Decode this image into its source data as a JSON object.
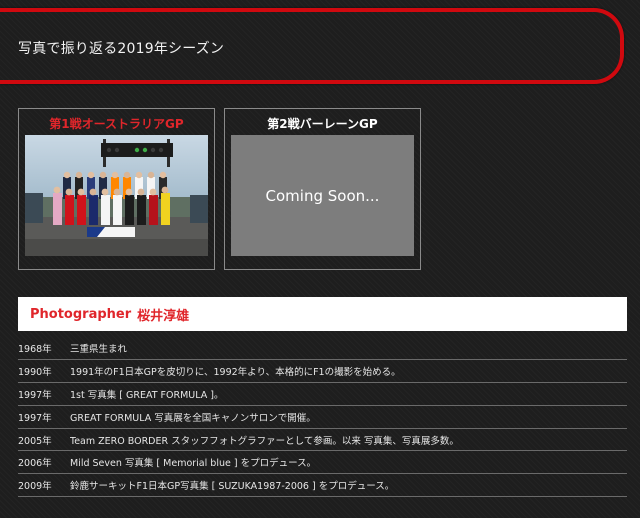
{
  "header": {
    "title": "写真で振り返る2019年シーズン",
    "border_color": "#d0090f"
  },
  "gp_cards": [
    {
      "title": "第1戦オーストラリアGP",
      "title_color": "#e0262b",
      "media": "team-photo"
    },
    {
      "title": "第2戦バーレーンGP",
      "title_color": "#ffffff",
      "placeholder_text": "Coming Soon..."
    }
  ],
  "photographer": {
    "label": "Photographer",
    "name": "桜井淳雄",
    "color": "#e0262b"
  },
  "history": [
    {
      "year": "1968年",
      "desc": "三重県生まれ"
    },
    {
      "year": "1990年",
      "desc": "1991年のF1日本GPを皮切りに、1992年より、本格的にF1の撮影を始める。"
    },
    {
      "year": "1997年",
      "desc": "1st 写真集 [ GREAT FORMULA ]。"
    },
    {
      "year": "1997年",
      "desc": "GREAT FORMULA 写真展を全国キャノンサロンで開催。"
    },
    {
      "year": "2005年",
      "desc": "Team ZERO BORDER スタッフフォトグラファーとして参画。以来 写真集、写真展多数。"
    },
    {
      "year": "2006年",
      "desc": "Mild Seven 写真集 [ Memorial blue ] をプロデュース。"
    },
    {
      "year": "2009年",
      "desc": "鈴鹿サーキットF1日本GP写真集 [ SUZUKA1987-2006 ] をプロデュース。"
    }
  ]
}
